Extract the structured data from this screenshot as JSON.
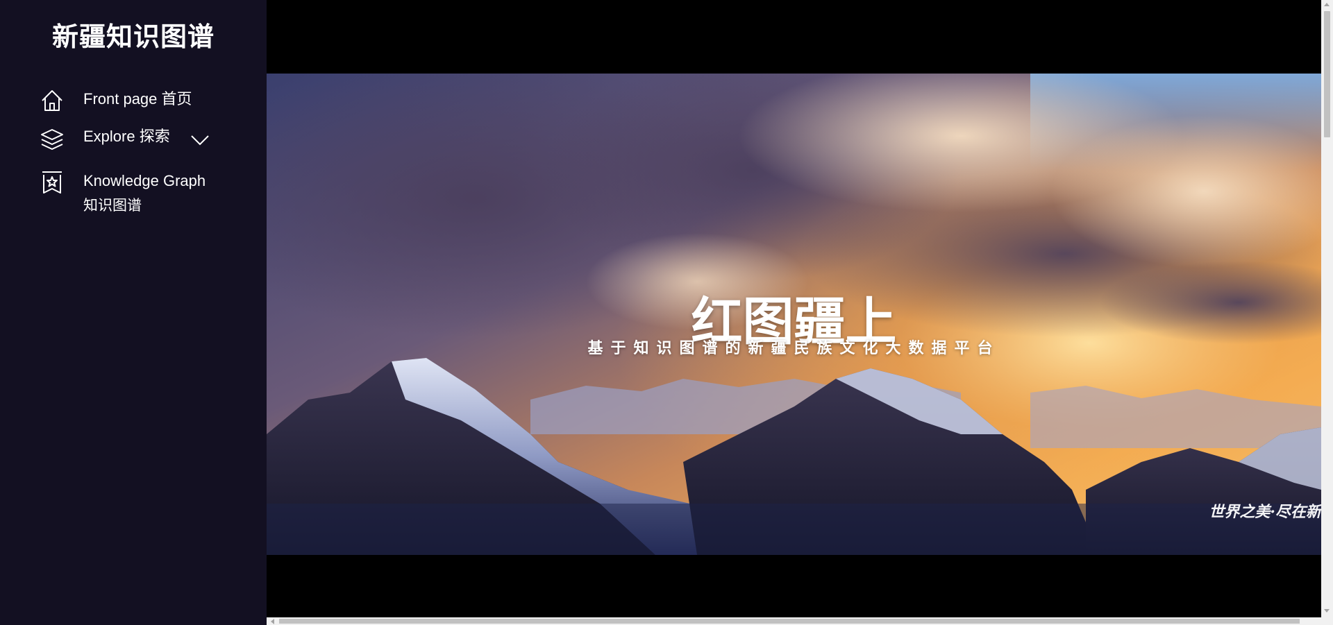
{
  "brand": {
    "title": "新疆知识图谱"
  },
  "nav": {
    "items": [
      {
        "label": "Front page 首页",
        "icon": "home-icon"
      },
      {
        "label": "Explore 探索",
        "icon": "layers-icon",
        "expandable": true
      },
      {
        "label": "Knowledge Graph",
        "sublabel": "知识图谱",
        "icon": "bookmark-star-icon"
      }
    ]
  },
  "hero": {
    "title": "红图疆上",
    "subtitle": "基于知识图谱的新疆民族文化大数据平台",
    "watermark": "世界之美·尽在新"
  },
  "colors": {
    "sidebar_bg": "#131022",
    "page_bg": "#000000",
    "text": "#ffffff"
  }
}
